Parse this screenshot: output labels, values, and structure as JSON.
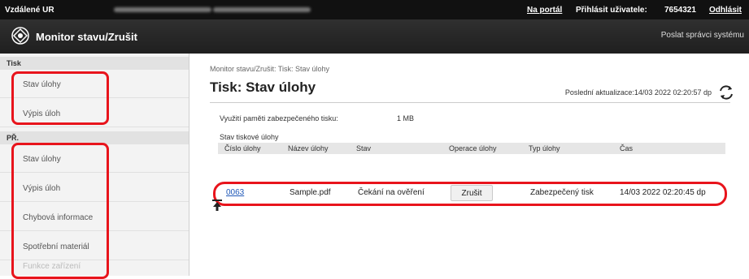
{
  "topbar": {
    "remote_ui": "Vzdálené UR",
    "portal_link": "Na portál",
    "login_label": "Přihlásit uživatele:",
    "user_id": "7654321",
    "logout_link": "Odhlásit"
  },
  "header": {
    "title": "Monitor stavu/Zrušit",
    "admin_mail": "Poslat správci systému"
  },
  "sidebar": {
    "sections": [
      {
        "label": "Tisk",
        "items": [
          "Stav úlohy",
          "Výpis úloh"
        ]
      },
      {
        "label": "PŘ.",
        "items": [
          "Stav úlohy",
          "Výpis úloh",
          "Chybová informace",
          "Spotřební materiál",
          "Funkce zařízení"
        ]
      }
    ]
  },
  "main": {
    "breadcrumb": "Monitor stavu/Zrušit: Tisk: Stav úlohy",
    "title": "Tisk: Stav úlohy",
    "last_update": "Poslední aktualizace:14/03 2022 02:20:57 dp",
    "memory_label": "Využití paměti zabezpečeného tisku:",
    "memory_value": "1 MB",
    "table_title": "Stav tiskové úlohy",
    "table": {
      "headers": [
        "Číslo úlohy",
        "Název úlohy",
        "Stav",
        "Operace úlohy",
        "Typ úlohy",
        "Čas"
      ],
      "row": {
        "job_number": "0063",
        "job_name": "Sample.pdf",
        "status": "Čekání na ověření",
        "action": "Zrušit",
        "type": "Zabezpečený tisk",
        "time": "14/03 2022 02:20:45 dp"
      }
    }
  },
  "colors": {
    "highlight": "#e8141c",
    "link": "#1f58b8",
    "topbar": "#111111"
  },
  "icons": {
    "logo": "gear-logo-icon",
    "refresh": "refresh-icon",
    "back_to_top": "back-to-top-icon"
  }
}
